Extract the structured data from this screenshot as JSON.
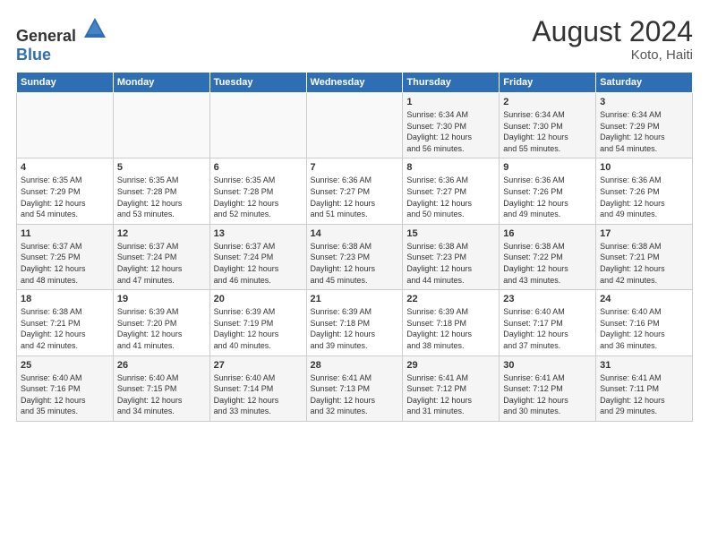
{
  "header": {
    "logo_general": "General",
    "logo_blue": "Blue",
    "main_title": "August 2024",
    "sub_title": "Koto, Haiti"
  },
  "days_of_week": [
    "Sunday",
    "Monday",
    "Tuesday",
    "Wednesday",
    "Thursday",
    "Friday",
    "Saturday"
  ],
  "weeks": [
    [
      {
        "day": "",
        "info": ""
      },
      {
        "day": "",
        "info": ""
      },
      {
        "day": "",
        "info": ""
      },
      {
        "day": "",
        "info": ""
      },
      {
        "day": "1",
        "info": "Sunrise: 6:34 AM\nSunset: 7:30 PM\nDaylight: 12 hours\nand 56 minutes."
      },
      {
        "day": "2",
        "info": "Sunrise: 6:34 AM\nSunset: 7:30 PM\nDaylight: 12 hours\nand 55 minutes."
      },
      {
        "day": "3",
        "info": "Sunrise: 6:34 AM\nSunset: 7:29 PM\nDaylight: 12 hours\nand 54 minutes."
      }
    ],
    [
      {
        "day": "4",
        "info": "Sunrise: 6:35 AM\nSunset: 7:29 PM\nDaylight: 12 hours\nand 54 minutes."
      },
      {
        "day": "5",
        "info": "Sunrise: 6:35 AM\nSunset: 7:28 PM\nDaylight: 12 hours\nand 53 minutes."
      },
      {
        "day": "6",
        "info": "Sunrise: 6:35 AM\nSunset: 7:28 PM\nDaylight: 12 hours\nand 52 minutes."
      },
      {
        "day": "7",
        "info": "Sunrise: 6:36 AM\nSunset: 7:27 PM\nDaylight: 12 hours\nand 51 minutes."
      },
      {
        "day": "8",
        "info": "Sunrise: 6:36 AM\nSunset: 7:27 PM\nDaylight: 12 hours\nand 50 minutes."
      },
      {
        "day": "9",
        "info": "Sunrise: 6:36 AM\nSunset: 7:26 PM\nDaylight: 12 hours\nand 49 minutes."
      },
      {
        "day": "10",
        "info": "Sunrise: 6:36 AM\nSunset: 7:26 PM\nDaylight: 12 hours\nand 49 minutes."
      }
    ],
    [
      {
        "day": "11",
        "info": "Sunrise: 6:37 AM\nSunset: 7:25 PM\nDaylight: 12 hours\nand 48 minutes."
      },
      {
        "day": "12",
        "info": "Sunrise: 6:37 AM\nSunset: 7:24 PM\nDaylight: 12 hours\nand 47 minutes."
      },
      {
        "day": "13",
        "info": "Sunrise: 6:37 AM\nSunset: 7:24 PM\nDaylight: 12 hours\nand 46 minutes."
      },
      {
        "day": "14",
        "info": "Sunrise: 6:38 AM\nSunset: 7:23 PM\nDaylight: 12 hours\nand 45 minutes."
      },
      {
        "day": "15",
        "info": "Sunrise: 6:38 AM\nSunset: 7:23 PM\nDaylight: 12 hours\nand 44 minutes."
      },
      {
        "day": "16",
        "info": "Sunrise: 6:38 AM\nSunset: 7:22 PM\nDaylight: 12 hours\nand 43 minutes."
      },
      {
        "day": "17",
        "info": "Sunrise: 6:38 AM\nSunset: 7:21 PM\nDaylight: 12 hours\nand 42 minutes."
      }
    ],
    [
      {
        "day": "18",
        "info": "Sunrise: 6:38 AM\nSunset: 7:21 PM\nDaylight: 12 hours\nand 42 minutes."
      },
      {
        "day": "19",
        "info": "Sunrise: 6:39 AM\nSunset: 7:20 PM\nDaylight: 12 hours\nand 41 minutes."
      },
      {
        "day": "20",
        "info": "Sunrise: 6:39 AM\nSunset: 7:19 PM\nDaylight: 12 hours\nand 40 minutes."
      },
      {
        "day": "21",
        "info": "Sunrise: 6:39 AM\nSunset: 7:18 PM\nDaylight: 12 hours\nand 39 minutes."
      },
      {
        "day": "22",
        "info": "Sunrise: 6:39 AM\nSunset: 7:18 PM\nDaylight: 12 hours\nand 38 minutes."
      },
      {
        "day": "23",
        "info": "Sunrise: 6:40 AM\nSunset: 7:17 PM\nDaylight: 12 hours\nand 37 minutes."
      },
      {
        "day": "24",
        "info": "Sunrise: 6:40 AM\nSunset: 7:16 PM\nDaylight: 12 hours\nand 36 minutes."
      }
    ],
    [
      {
        "day": "25",
        "info": "Sunrise: 6:40 AM\nSunset: 7:16 PM\nDaylight: 12 hours\nand 35 minutes."
      },
      {
        "day": "26",
        "info": "Sunrise: 6:40 AM\nSunset: 7:15 PM\nDaylight: 12 hours\nand 34 minutes."
      },
      {
        "day": "27",
        "info": "Sunrise: 6:40 AM\nSunset: 7:14 PM\nDaylight: 12 hours\nand 33 minutes."
      },
      {
        "day": "28",
        "info": "Sunrise: 6:41 AM\nSunset: 7:13 PM\nDaylight: 12 hours\nand 32 minutes."
      },
      {
        "day": "29",
        "info": "Sunrise: 6:41 AM\nSunset: 7:12 PM\nDaylight: 12 hours\nand 31 minutes."
      },
      {
        "day": "30",
        "info": "Sunrise: 6:41 AM\nSunset: 7:12 PM\nDaylight: 12 hours\nand 30 minutes."
      },
      {
        "day": "31",
        "info": "Sunrise: 6:41 AM\nSunset: 7:11 PM\nDaylight: 12 hours\nand 29 minutes."
      }
    ]
  ]
}
